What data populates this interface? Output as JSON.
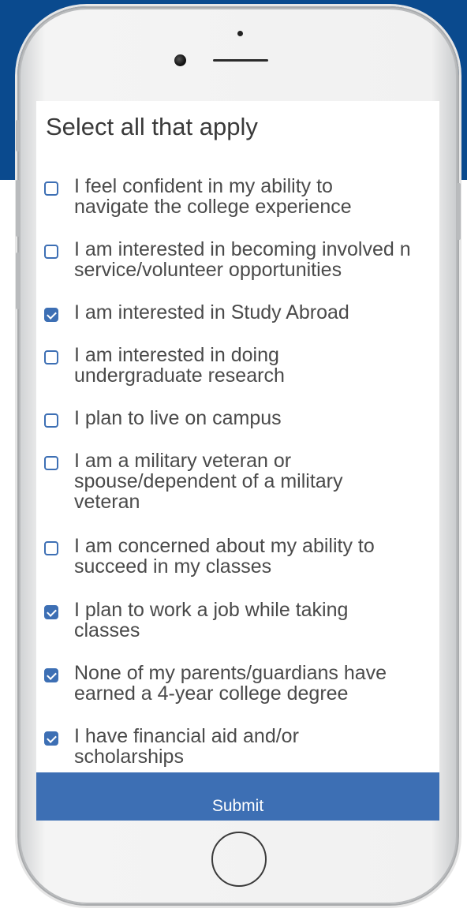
{
  "survey": {
    "heading": "Select all that apply",
    "options": [
      {
        "label": "I feel confident in my ability to navigate the college experience",
        "checked": false
      },
      {
        "label": "I am interested in becoming involved n service/volunteer opportunities",
        "checked": false
      },
      {
        "label": "I am interested in Study Abroad",
        "checked": true
      },
      {
        "label": "I am interested in doing undergraduate research",
        "checked": false
      },
      {
        "label": "I plan to live on campus",
        "checked": false
      },
      {
        "label": "I am a military veteran or spouse/dependent of a military veteran",
        "checked": false
      },
      {
        "label": "I am concerned about my ability to succeed in my classes",
        "checked": false
      },
      {
        "label": "I plan to work a job while taking classes",
        "checked": true
      },
      {
        "label": "None of my parents/guardians have earned a 4-year college degree",
        "checked": true
      },
      {
        "label": "I have financial aid and/or scholarships",
        "checked": true
      }
    ],
    "submit_label": "Submit"
  },
  "colors": {
    "accent": "#3d6fb4",
    "background_band": "#0a4a8e"
  }
}
